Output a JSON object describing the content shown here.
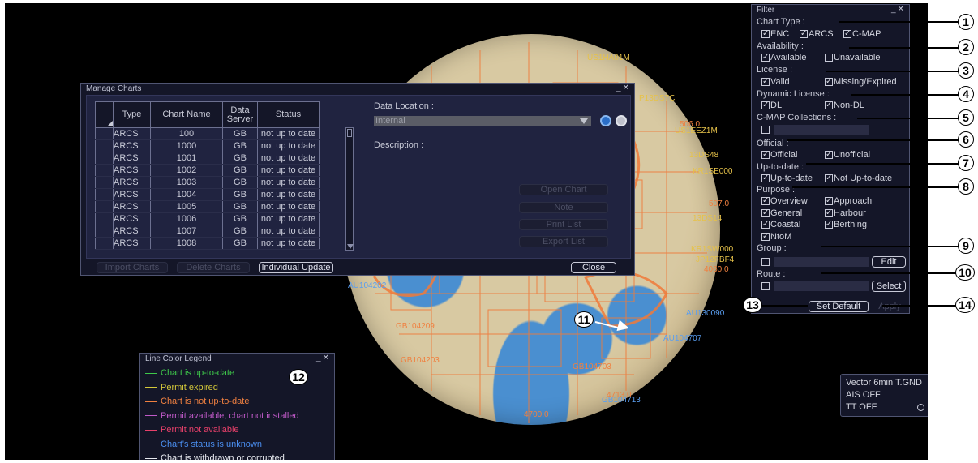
{
  "chart_labels": [
    {
      "text": "US1HA01M",
      "cls": "lbl-y"
    },
    {
      "text": "US1EEZ1M",
      "cls": "lbl-y"
    },
    {
      "text": "P13DS7C",
      "cls": "lbl-y"
    },
    {
      "text": "13DS48",
      "cls": "lbl-y"
    },
    {
      "text": "KR1SE000",
      "cls": "lbl-y"
    },
    {
      "text": "13DS14",
      "cls": "lbl-y"
    },
    {
      "text": "KR1SW000",
      "cls": "lbl-y"
    },
    {
      "text": "JP12FBF4",
      "cls": "lbl-y"
    },
    {
      "text": "4060.0",
      "cls": "lbl-o"
    },
    {
      "text": "507.0",
      "cls": "lbl-o"
    },
    {
      "text": "506.0",
      "cls": "lbl-o"
    },
    {
      "text": "AU130090",
      "cls": "lbl-b"
    },
    {
      "text": "AU104707",
      "cls": "lbl-b"
    },
    {
      "text": "AU104202",
      "cls": "lbl-b"
    },
    {
      "text": "GB104209",
      "cls": "lbl-o"
    },
    {
      "text": "GB104203",
      "cls": "lbl-o"
    },
    {
      "text": "GB104703",
      "cls": "lbl-o"
    },
    {
      "text": "4700.0",
      "cls": "lbl-o"
    },
    {
      "text": "GB104713",
      "cls": "lbl-b"
    },
    {
      "text": "4713.0",
      "cls": "lbl-o"
    }
  ],
  "manage": {
    "title": "Manage Charts",
    "columns": [
      "Type",
      "Chart Name",
      "Data Server",
      "Status"
    ],
    "rows": [
      [
        "ARCS",
        "100",
        "GB",
        "not up to date"
      ],
      [
        "ARCS",
        "1000",
        "GB",
        "not up to date"
      ],
      [
        "ARCS",
        "1001",
        "GB",
        "not up to date"
      ],
      [
        "ARCS",
        "1002",
        "GB",
        "not up to date"
      ],
      [
        "ARCS",
        "1003",
        "GB",
        "not up to date"
      ],
      [
        "ARCS",
        "1004",
        "GB",
        "not up to date"
      ],
      [
        "ARCS",
        "1005",
        "GB",
        "not up to date"
      ],
      [
        "ARCS",
        "1006",
        "GB",
        "not up to date"
      ],
      [
        "ARCS",
        "1007",
        "GB",
        "not up to date"
      ],
      [
        "ARCS",
        "1008",
        "GB",
        "not up to date"
      ]
    ],
    "data_location_label": "Data Location :",
    "data_location_value": "Internal",
    "description_label": "Description :",
    "open_chart": "Open Chart",
    "note": "Note",
    "print_list": "Print List",
    "export_list": "Export List",
    "import_charts": "Import Charts",
    "delete_charts": "Delete Charts",
    "individual_update": "Individual Update",
    "close": "Close"
  },
  "filter": {
    "title": "Filter",
    "chart_type": "Chart Type :",
    "enc": "ENC",
    "arcs": "ARCS",
    "cmap": "C-MAP",
    "availability": "Availability :",
    "available": "Available",
    "unavailable": "Unavailable",
    "license": "License :",
    "valid": "Valid",
    "missing": "Missing/Expired",
    "dyn_license": "Dynamic License :",
    "dl": "DL",
    "non_dl": "Non-DL",
    "cmap_collections": "C-MAP Collections :",
    "official_h": "Official :",
    "official": "Official",
    "unofficial": "Unofficial",
    "uptodate_h": "Up-to-date :",
    "uptodate": "Up-to-date",
    "not_uptodate": "Not Up-to-date",
    "purpose": "Purpose :",
    "overview": "Overview",
    "approach": "Approach",
    "general": "General",
    "harbour": "Harbour",
    "coastal": "Coastal",
    "berthing": "Berthing",
    "ntom": "NtoM",
    "group": "Group :",
    "edit": "Edit",
    "route": "Route :",
    "select": "Select",
    "set_default": "Set Default",
    "apply": "Apply"
  },
  "callouts": [
    "1",
    "2",
    "3",
    "4",
    "5",
    "6",
    "7",
    "8",
    "9",
    "10",
    "11",
    "12",
    "13",
    "14"
  ],
  "legend": {
    "title": "Line Color Legend",
    "items": [
      {
        "text": "Chart is up-to-date",
        "color": "#3ec84a"
      },
      {
        "text": "Permit expired",
        "color": "#d4c83a"
      },
      {
        "text": "Chart is not up-to-date",
        "color": "#f08040"
      },
      {
        "text": "Permit available, chart not installed",
        "color": "#c05ac8"
      },
      {
        "text": "Permit not available",
        "color": "#e8406a"
      },
      {
        "text": "Chart's status is unknown",
        "color": "#4a8ef0"
      },
      {
        "text": "Chart is withdrawn or corrupted",
        "color": "#e8eaf0"
      }
    ]
  },
  "info": {
    "line1": "Vector 6min T.GND",
    "line2": "AIS OFF",
    "line3": "TT OFF"
  }
}
